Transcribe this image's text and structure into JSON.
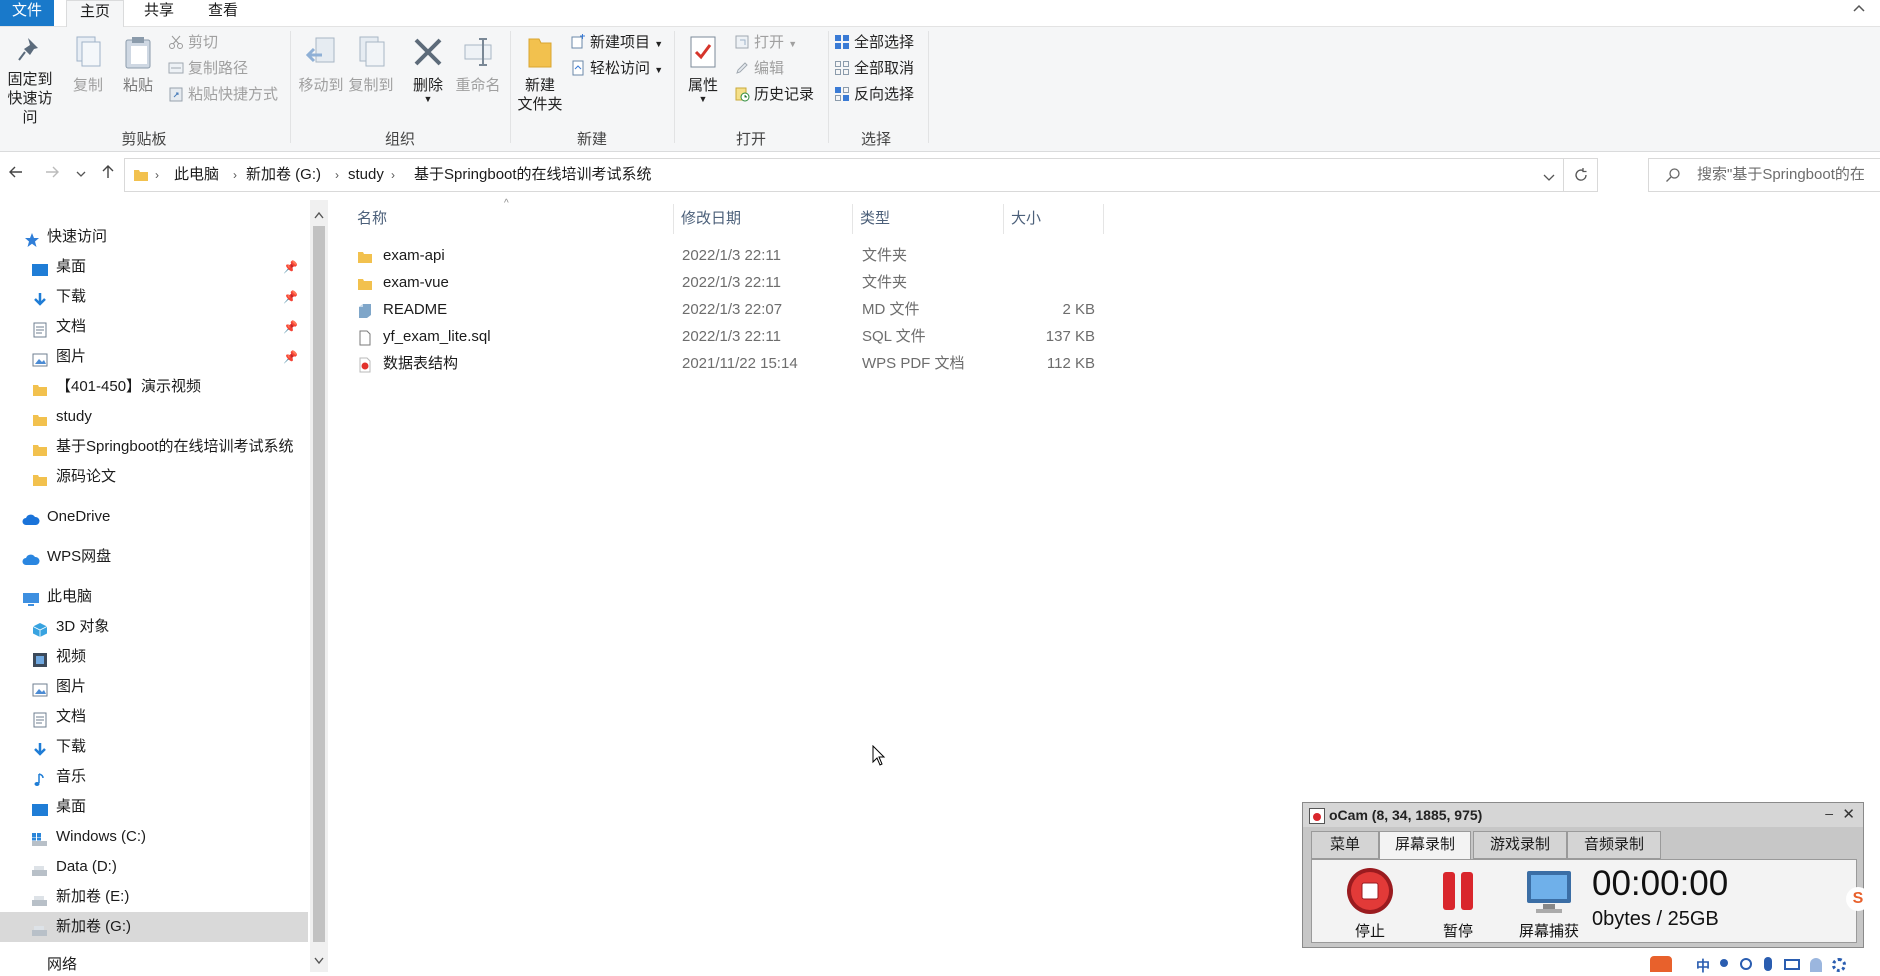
{
  "ribbon_tabs": [
    "文件",
    "主页",
    "共享",
    "查看"
  ],
  "clipboard": {
    "pin_label_1": "固定到",
    "pin_label_2": "快速访问",
    "copy": "复制",
    "paste": "粘贴",
    "cut": "剪切",
    "copy_path": "复制路径",
    "paste_shortcut": "粘贴快捷方式",
    "group": "剪贴板"
  },
  "organize": {
    "move_to": "移动到",
    "copy_to": "复制到",
    "delete": "删除",
    "rename": "重命名",
    "group": "组织"
  },
  "new": {
    "new_folder_1": "新建",
    "new_folder_2": "文件夹",
    "new_item": "新建项目",
    "easy_access": "轻松访问",
    "group": "新建"
  },
  "open": {
    "properties": "属性",
    "open": "打开",
    "edit": "编辑",
    "history": "历史记录",
    "group": "打开"
  },
  "select": {
    "select_all": "全部选择",
    "select_none": "全部取消",
    "invert": "反向选择",
    "group": "选择"
  },
  "breadcrumb": [
    "此电脑",
    "新加卷 (G:)",
    "study",
    "基于Springboot的在线培训考试系统"
  ],
  "search_placeholder": "搜索\"基于Springboot的在",
  "nav": {
    "quick_access": "快速访问",
    "quick_items": [
      "桌面",
      "下载",
      "文档",
      "图片"
    ],
    "folders": [
      "【401-450】演示视频",
      "study",
      "基于Springboot的在线培训考试系统",
      "源码论文"
    ],
    "onedrive": "OneDrive",
    "wps": "WPS网盘",
    "this_pc": "此电脑",
    "pc_items": [
      "3D 对象",
      "视频",
      "图片",
      "文档",
      "下载",
      "音乐",
      "桌面",
      "Windows (C:)",
      "Data (D:)",
      "新加卷 (E:)",
      "新加卷 (G:)"
    ],
    "network": "网络"
  },
  "columns": {
    "name": "名称",
    "date": "修改日期",
    "type": "类型",
    "size": "大小"
  },
  "files": [
    {
      "name": "exam-api",
      "date": "2022/1/3 22:11",
      "type": "文件夹",
      "size": "",
      "icon": "folder"
    },
    {
      "name": "exam-vue",
      "date": "2022/1/3 22:11",
      "type": "文件夹",
      "size": "",
      "icon": "folder"
    },
    {
      "name": "README",
      "date": "2022/1/3 22:07",
      "type": "MD 文件",
      "size": "2 KB",
      "icon": "md"
    },
    {
      "name": "yf_exam_lite.sql",
      "date": "2022/1/3 22:11",
      "type": "SQL 文件",
      "size": "137 KB",
      "icon": "file"
    },
    {
      "name": "数据表结构",
      "date": "2021/11/22 15:14",
      "type": "WPS PDF 文档",
      "size": "112 KB",
      "icon": "pdf"
    }
  ],
  "ocam": {
    "title": "oCam (8, 34, 1885, 975)",
    "tabs": [
      "菜单",
      "屏幕录制",
      "游戏录制",
      "音频录制"
    ],
    "stop": "停止",
    "pause": "暂停",
    "capture": "屏幕捕获",
    "time": "00:00:00",
    "size": "0bytes / 25GB"
  },
  "tray_text": "中",
  "colors": {
    "accent": "#1979ca",
    "folder": "#f2c14e",
    "ocam_red": "#d9262c"
  }
}
